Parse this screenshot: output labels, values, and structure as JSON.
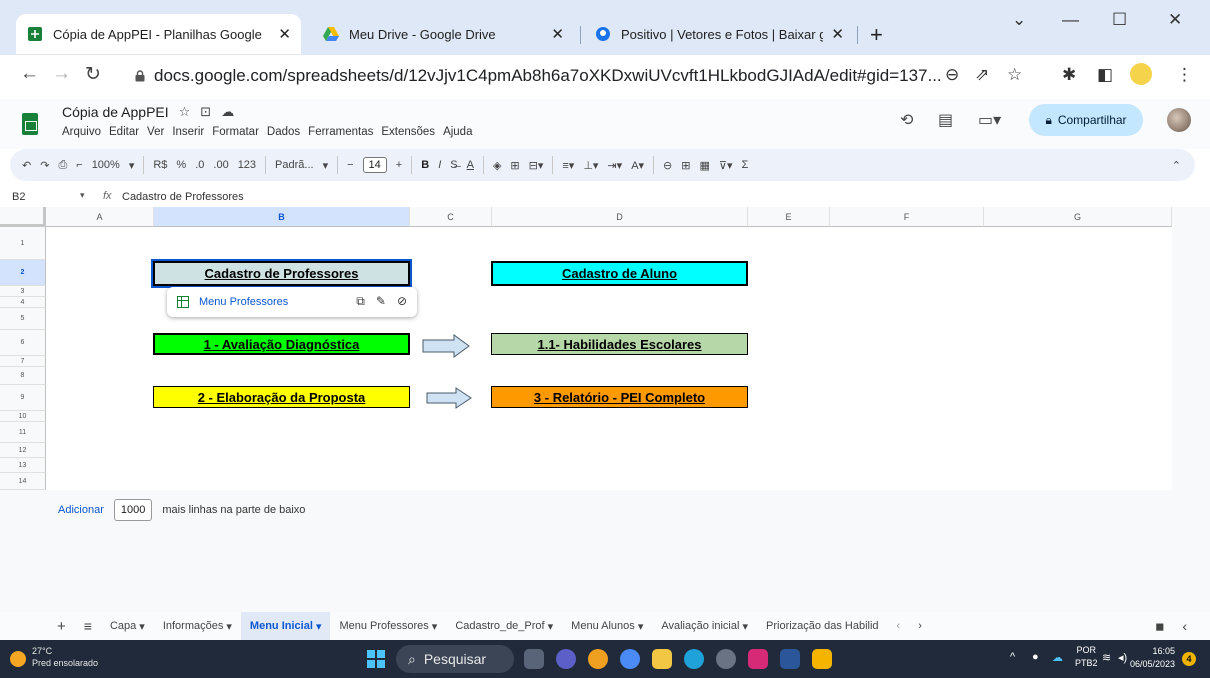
{
  "browser": {
    "tabs": [
      {
        "title": "Cópia de AppPEI - Planilhas Google",
        "active": true
      },
      {
        "title": "Meu Drive - Google Drive",
        "active": false
      },
      {
        "title": "Positivo | Vetores e Fotos | Baixar gr",
        "active": false
      }
    ],
    "url": "docs.google.com/spreadsheets/d/12vJjv1C4pmAb8h6a7oXKDxwiUVcvft1HLkbodGJIAdA/edit#gid=137..."
  },
  "sheets": {
    "title": "Cópia de AppPEI",
    "menus": [
      "Arquivo",
      "Editar",
      "Ver",
      "Inserir",
      "Formatar",
      "Dados",
      "Ferramentas",
      "Extensões",
      "Ajuda"
    ],
    "share_label": "Compartilhar",
    "toolbar": {
      "zoom": "100%",
      "currency": "R$",
      "percent": "%",
      "dec_decrease": ".0",
      "dec_increase": ".00",
      "number_format": "123",
      "font": "Padrã...",
      "font_size": "14",
      "bold": "B",
      "italic": "I"
    },
    "formula_bar": {
      "cell_ref": "B2",
      "fx": "fx",
      "value": "Cadastro de Professores"
    },
    "columns": [
      "A",
      "B",
      "C",
      "D",
      "E",
      "F",
      "G"
    ],
    "rows": [
      "1",
      "2",
      "3",
      "4",
      "5",
      "6",
      "7",
      "8",
      "9",
      "10",
      "11",
      "12",
      "13",
      "14"
    ],
    "cells": {
      "cadastro_prof": "Cadastro de Professores",
      "cadastro_aluno": "Cadastro de Aluno",
      "avaliacao": "1 - Avaliação Diagnóstica",
      "habilidades": "1.1-  Habilidades Escolares",
      "elaboracao": "2 - Elaboração da Proposta",
      "relatorio": "3 - Relatório - PEI Completo"
    },
    "link_chip": {
      "label": "Menu Professores"
    },
    "add_rows": {
      "link": "Adicionar",
      "count": "1000",
      "suffix": "mais linhas na parte de baixo"
    },
    "sheet_tabs": [
      "Capa",
      "Informações",
      "Menu Inicial",
      "Menu Professores",
      "Cadastro_de_Prof",
      "Menu Alunos",
      "Avaliação inicial",
      "Priorização das Habilid"
    ],
    "active_sheet": "Menu Inicial"
  },
  "colors": {
    "cell_prof": "#cfe2e3",
    "cell_aluno": "#00ffff",
    "cell_avaliacao": "#00ff00",
    "cell_habilidades": "#b6d7a8",
    "cell_elaboracao": "#ffff00",
    "cell_relatorio": "#ff9900",
    "accent": "#0b57d0"
  },
  "taskbar": {
    "temp": "27°C",
    "weather": "Pred ensolarado",
    "search": "Pesquisar",
    "lang1": "POR",
    "lang2": "PTB2",
    "time": "16:05",
    "date": "06/05/2023",
    "notifications": "4"
  }
}
